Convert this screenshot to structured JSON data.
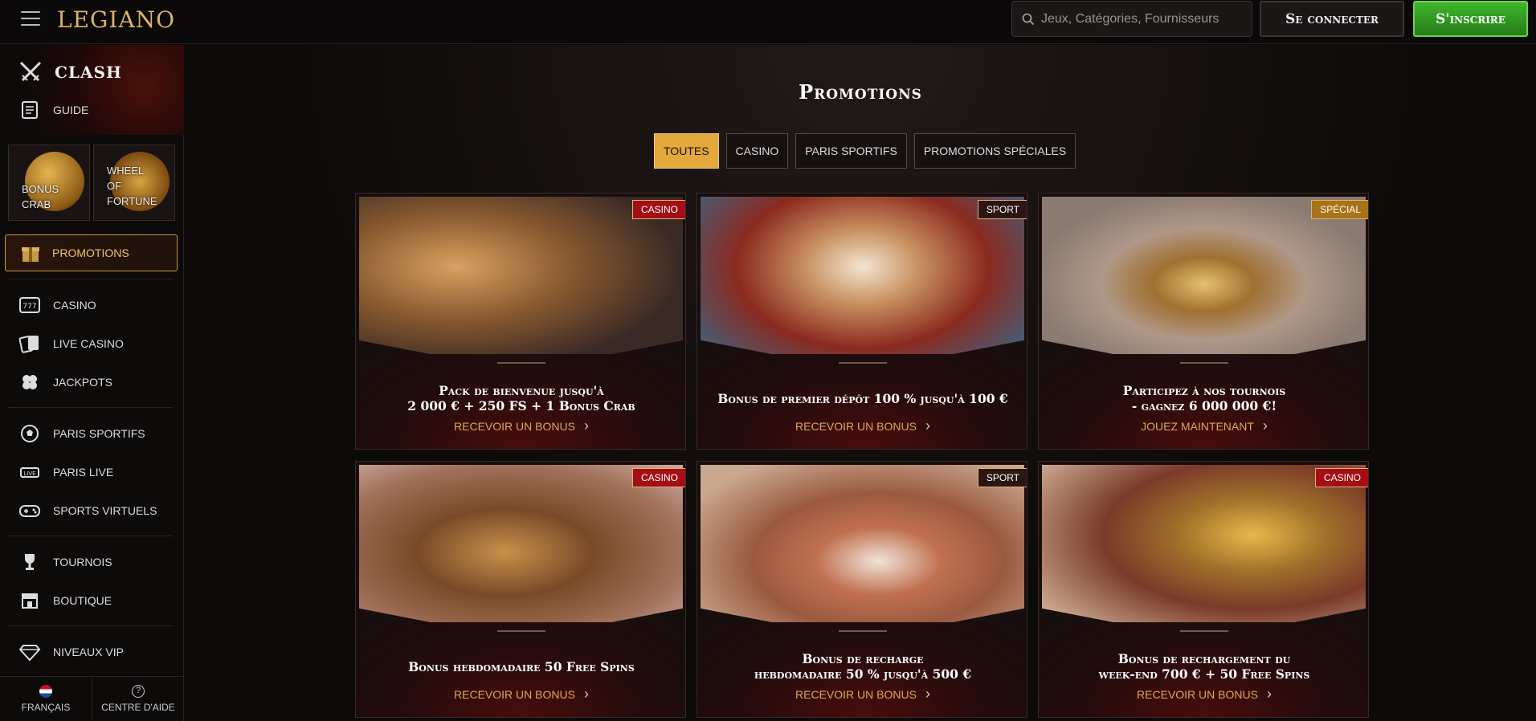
{
  "header": {
    "logo": "LEGIANO",
    "search_placeholder": "Jeux, Catégories, Fournisseurs",
    "login_label": "Se connecter",
    "signup_label": "S'inscrire"
  },
  "sidebar": {
    "clash": "CLASH",
    "guide": "GUIDE",
    "tiles": [
      {
        "line1": "BONUS",
        "line2": "CRAB",
        "line3": ""
      },
      {
        "line1": "WHEEL",
        "line2": "OF",
        "line3": "FORTUNE"
      }
    ],
    "promotions": "PROMOTIONS",
    "group1": [
      "CASINO",
      "LIVE CASINO",
      "JACKPOTS"
    ],
    "group2": [
      "PARIS SPORTIFS",
      "PARIS LIVE",
      "SPORTS VIRTUELS"
    ],
    "group3": [
      "TOURNOIS",
      "BOUTIQUE"
    ],
    "vip": "NIVEAUX VIP",
    "language": "FRANÇAIS",
    "help": "CENTRE D'AIDE"
  },
  "main": {
    "title": "Promotions",
    "filters": [
      "TOUTES",
      "CASINO",
      "PARIS SPORTIFS",
      "PROMOTIONS SPÉCIALES"
    ],
    "active_filter": 0,
    "cards": [
      {
        "badge": "CASINO",
        "title1": "Pack de bienvenue jusqu'à",
        "title2": "2 000 € + 250 FS + 1 Bonus Crab",
        "cta": "RECEVOIR UN BONUS"
      },
      {
        "badge": "SPORT",
        "title1": "Bonus de premier dépôt 100 % jusqu'à 100 €",
        "title2": "",
        "cta": "RECEVOIR UN BONUS"
      },
      {
        "badge": "SPÉCIAL",
        "title1": "Participez à nos tournois",
        "title2": "- gagnez 6 000 000 €!",
        "cta": "JOUEZ MAINTENANT"
      },
      {
        "badge": "CASINO",
        "title1": "Bonus hebdomadaire 50 Free Spins",
        "title2": "",
        "cta": "RECEVOIR UN BONUS"
      },
      {
        "badge": "SPORT",
        "title1": "Bonus de recharge",
        "title2": "hebdomadaire 50 % jusqu'à 500 €",
        "cta": "RECEVOIR UN BONUS"
      },
      {
        "badge": "CASINO",
        "title1": "Bonus de rechargement du",
        "title2": "week-end 700 € + 50 Free Spins",
        "cta": "RECEVOIR UN BONUS"
      }
    ]
  },
  "colors": {
    "accent_gold": "#e3a93e",
    "signup_green": "#3fb52a",
    "badge_casino": "#a30f14",
    "badge_special": "#a87218"
  }
}
